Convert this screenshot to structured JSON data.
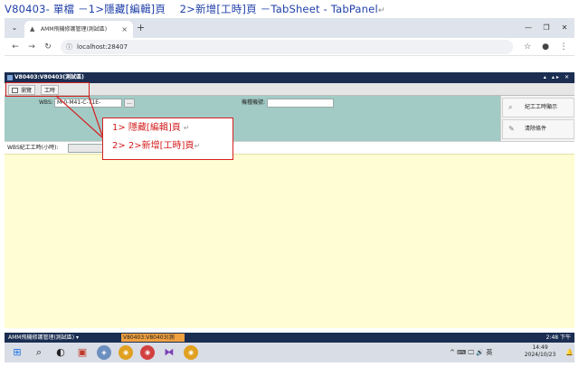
{
  "doc_title": {
    "text": "V80403- 單檔 －1>隱藏[編輯]頁　 2>新增[工時]頁 －TabSheet - TabPanel",
    "mark": "↵"
  },
  "browser": {
    "tab_title": "AMM飛機修護管理(測試區)",
    "tab_close": "×",
    "new_tab": "+",
    "tab_dropdown": "⌄",
    "address": "localhost:28407",
    "window_controls": {
      "minimize": "—",
      "maximize": "❐",
      "close": "✕"
    }
  },
  "app": {
    "window_title": "V80403:V80403(測試區)",
    "window_controls": "▴ ▴▸ ✕",
    "tabs": [
      {
        "label": "瀏覽",
        "icon": "grid-icon"
      },
      {
        "label": "工時"
      }
    ],
    "form": {
      "wbs_label": "WBS:",
      "wbs_value": "M-0-M41-C-71E-",
      "wbs_button": "...",
      "aircraft_label": "機種機號:",
      "aircraft_value": "",
      "wbs_hours_label": "WBS紀工工時(小時):",
      "wbs_hours_value": ""
    },
    "side_buttons": [
      {
        "label": "紀工工時顯示",
        "icon": "search-icon"
      },
      {
        "label": "清除條件",
        "icon": "eraser-icon"
      }
    ]
  },
  "callout": {
    "line1": "1> 隱藏[編輯]頁",
    "line2": "2> 2>新增[工時]頁",
    "mark": "↵"
  },
  "status_bar": {
    "menu": "AMM飛機修護管理(測試區) ▾",
    "task": "V80403:V80403(測",
    "time": "2:48 下午"
  },
  "taskbar": {
    "tray": "^ ⌨ 🖵 🔊 英",
    "clock_time": "14:49",
    "clock_date": "2024/10/23"
  }
}
